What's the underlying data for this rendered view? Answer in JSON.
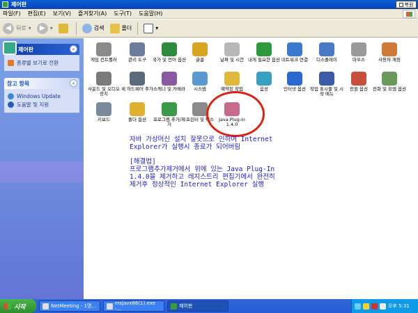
{
  "window": {
    "title": "제어판",
    "restore_label": "복원"
  },
  "menu": [
    "파일(F)",
    "편집(E)",
    "보기(V)",
    "즐겨찾기(A)",
    "도구(T)",
    "도움말(H)"
  ],
  "toolbar": {
    "back": "뒤로",
    "search": "검색",
    "folders": "폴더"
  },
  "sidebar": {
    "panel1_title": "제어판",
    "switch_view": "종류별 보기로 전환",
    "panel2_title": "참고 항목",
    "links": [
      "Windows Update",
      "도움말 및 지원"
    ]
  },
  "icons": [
    {
      "label": "게임 컨트롤러",
      "color": "#8a8a8a"
    },
    {
      "label": "관리 도구",
      "color": "#6b7d9c"
    },
    {
      "label": "국가 및 언어 옵션",
      "color": "#2e8b3e"
    },
    {
      "label": "글꼴",
      "color": "#d9a520"
    },
    {
      "label": "날짜 및 시간",
      "color": "#b8b8b8"
    },
    {
      "label": "내게 필요한 옵션",
      "color": "#2a9a3a"
    },
    {
      "label": "네트워크 연결",
      "color": "#3a7ad0"
    },
    {
      "label": "디스플레이",
      "color": "#4a78c8"
    },
    {
      "label": "마우스",
      "color": "#9a9a9a"
    },
    {
      "label": "사용자 계정",
      "color": "#d27a3a"
    },
    {
      "label": "사운드 및 오디오 장치",
      "color": "#7a7a7a"
    },
    {
      "label": "새 하드웨어 추가",
      "color": "#5a6a7a"
    },
    {
      "label": "스캐너 및 카메라",
      "color": "#8a5aa0"
    },
    {
      "label": "시스템",
      "color": "#5a9ad0"
    },
    {
      "label": "예약된 작업",
      "color": "#e0b83a"
    },
    {
      "label": "음성",
      "color": "#3aa0c0"
    },
    {
      "label": "인터넷 옵션",
      "color": "#2a6ad0"
    },
    {
      "label": "작업 표시줄 및 시작 메뉴",
      "color": "#3a5aa8"
    },
    {
      "label": "전원 옵션",
      "color": "#c8503a"
    },
    {
      "label": "전화 및 모뎀 옵션",
      "color": "#6a9a5a"
    },
    {
      "label": "키보드",
      "color": "#7a8a9a"
    },
    {
      "label": "폴더 옵션",
      "color": "#e0b030"
    },
    {
      "label": "프로그램 추가/제거",
      "color": "#3a9a4a"
    },
    {
      "label": "프린터 및 팩스",
      "color": "#8a8a8a"
    },
    {
      "label": "Java Plug-in 1.4.0",
      "color": "#c86a8a"
    }
  ],
  "note": {
    "line1": "자바 가상머신 설치 잘못으로 인하여 Internet",
    "line2": "Explorer가 실행시 종료가 되어버림",
    "heading": "[해결법]",
    "line3": "프로그램추가제거에서 위에 있는 Java Plug-In",
    "line4": "1.4.0을 제거하고 레지스트리 편집기에서 완전히",
    "line5": "제거후 정상적인 Internet Explorer 실행"
  },
  "taskbar": {
    "start": "시작",
    "tasks": [
      "NetMeeting - 1명...",
      "msjavx86(1).exe -...",
      "제어판"
    ],
    "clock": "오후 5:31"
  }
}
